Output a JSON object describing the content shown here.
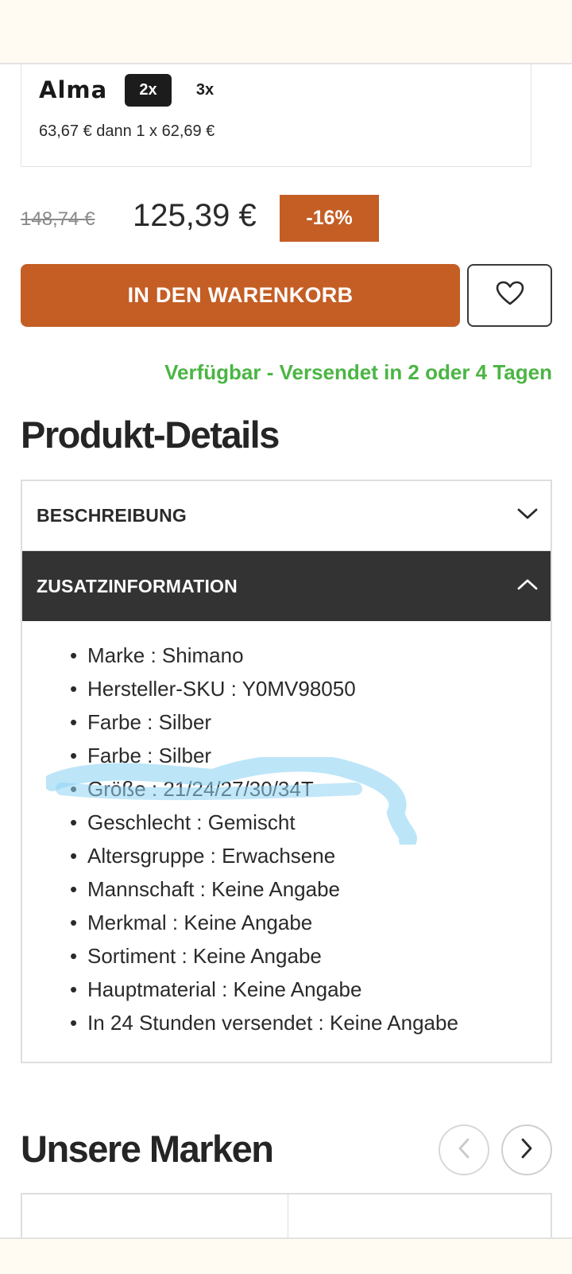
{
  "alma": {
    "logo_text": "Alma",
    "options": [
      "2x",
      "3x"
    ],
    "installments": "63,67 € dann 1 x 62,69 €"
  },
  "pricing": {
    "old_price": "148,74 €",
    "new_price": "125,39 €",
    "discount": "-16%"
  },
  "actions": {
    "add_to_cart": "IN DEN WARENKORB",
    "wishlist_icon": "heart-icon"
  },
  "availability": "Verfügbar - Versendet in 2 oder 4 Tagen",
  "product_details": {
    "title": "Produkt-Details",
    "accordion": [
      {
        "label": "BESCHREIBUNG",
        "icon": "chevron-down-icon",
        "expanded": false
      },
      {
        "label": "ZUSATZINFORMATION",
        "icon": "chevron-up-icon",
        "expanded": true
      }
    ],
    "info": [
      "Marke : Shimano",
      "Hersteller-SKU : Y0MV98050",
      "Farbe : Silber",
      "Farbe : Silber",
      "Größe : 21/24/27/30/34T",
      "Geschlecht : Gemischt",
      "Altersgruppe : Erwachsene",
      "Mannschaft : Keine Angabe",
      "Merkmal : Keine Angabe",
      "Sortiment : Keine Angabe",
      "Hauptmaterial : Keine Angabe",
      "In 24 Stunden versendet : Keine Angabe"
    ]
  },
  "brands": {
    "title": "Unsere Marken",
    "prev_icon": "chevron-left-icon",
    "next_icon": "chevron-right-icon"
  },
  "colors": {
    "accent_orange": "#c45e25",
    "availability_green": "#4bb543",
    "active_accordion": "#333333",
    "highlight_scribble": "#8fd3f4"
  }
}
